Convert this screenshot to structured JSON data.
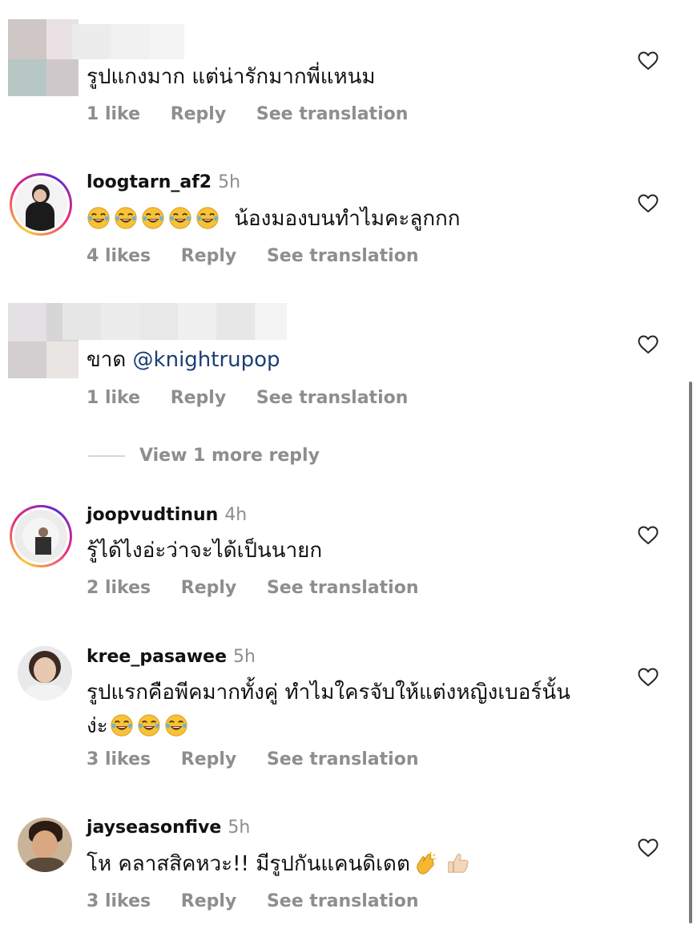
{
  "comments": [
    {
      "username": "",
      "time": "",
      "text": "รูปแกงมาก แต่น่ารักมากพี่แหนม",
      "likes": "1 like",
      "reply": "Reply",
      "translate": "See translation"
    },
    {
      "username": "loogtarn_af2",
      "time": "5h",
      "text": "น้องมองบนทำไมคะลูกกก",
      "likes": "4 likes",
      "reply": "Reply",
      "translate": "See translation"
    },
    {
      "username": "",
      "time": "",
      "text_prefix": "ขาด",
      "mention": "@knightrupop",
      "likes": "1 like",
      "reply": "Reply",
      "translate": "See translation"
    },
    {
      "username": "joopvudtinun",
      "time": "4h",
      "text": "รู้ได้ไงอ่ะว่าจะได้เป็นนายก",
      "likes": "2 likes",
      "reply": "Reply",
      "translate": "See translation"
    },
    {
      "username": "kree_pasawee",
      "time": "5h",
      "text_line1": "รูปแรกคือพีคมากทั้งคู่ ทำไมใครจับให้แต่งหญิงเบอร์นั้น",
      "text_line2": "ง่ะ",
      "likes": "3 likes",
      "reply": "Reply",
      "translate": "See translation"
    },
    {
      "username": "jayseasonfive",
      "time": "5h",
      "text": "โห คลาสสิคหวะ!! มีรูปกันแคนดิเดต",
      "likes": "3 likes",
      "reply": "Reply",
      "translate": "See translation"
    }
  ],
  "view_more_replies": "View 1 more reply",
  "icons": {
    "heart": "heart-outline-icon",
    "laugh": "face-with-tears-of-joy-emoji",
    "clap": "clapping-hands-emoji",
    "thumbs": "thumbs-up-emoji"
  },
  "colors": {
    "secondary_text": "#8e8e8e",
    "mention": "#1c3f73",
    "story_ring": "#ee2a7b"
  }
}
